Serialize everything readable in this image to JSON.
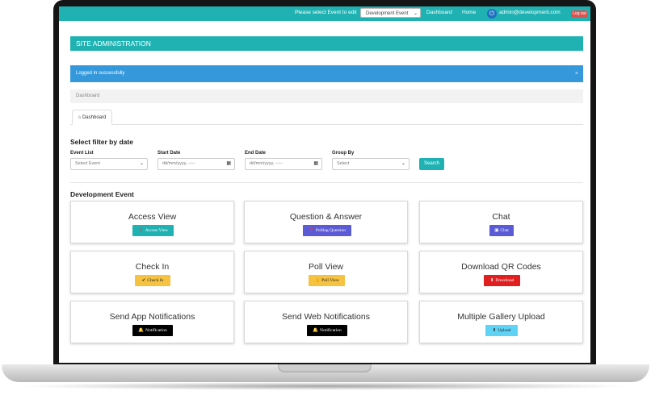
{
  "nav": {
    "select_prompt": "Please select Event to edit",
    "selected_event": "Development Event",
    "dashboard_link": "Dashboard",
    "home_link": "Home",
    "user_email": "admin@development.com",
    "logout_label": "Log out"
  },
  "admin_title": "SITE ADMINISTRATION",
  "alert": {
    "message": "Logged in successfully",
    "close": "×"
  },
  "breadcrumb": "Dashboard",
  "tab": {
    "label": "Dashboard",
    "icon": "home-icon"
  },
  "filter": {
    "title": "Select filter by date",
    "event_list_label": "Event List",
    "event_list_value": "Select Event",
    "start_date_label": "Start Date",
    "start_date_value": "dd/mm/yyyy, --:--",
    "end_date_label": "End Date",
    "end_date_value": "dd/mm/yyyy, --:--",
    "group_by_label": "Group By",
    "group_by_value": "Select",
    "search_label": "Search"
  },
  "section_title": "Development Event",
  "cards": [
    {
      "title": "Access View",
      "button": "Access View",
      "icon": "question-circle-icon",
      "color": "#20b2b2"
    },
    {
      "title": "Question & Answer",
      "button": "Polling Question",
      "icon": "question-circle-icon",
      "color": "#5b5bd6"
    },
    {
      "title": "Chat",
      "button": "Chat",
      "icon": "chat-icon",
      "color": "#5b5bd6"
    },
    {
      "title": "Check In",
      "button": "Check In",
      "icon": "check-icon",
      "color": "#f5c242"
    },
    {
      "title": "Poll View",
      "button": "Poll View",
      "icon": "thumbs-up-icon",
      "color": "#f5c242"
    },
    {
      "title": "Download QR Codes",
      "button": "Download",
      "icon": "download-icon",
      "color": "#e02020"
    },
    {
      "title": "Send App Notifications",
      "button": "Notification",
      "icon": "bell-icon",
      "color": "#000000"
    },
    {
      "title": "Send Web Notifications",
      "button": "Notification",
      "icon": "bell-icon",
      "color": "#000000"
    },
    {
      "title": "Multiple Gallery Upload",
      "button": "Upload",
      "icon": "upload-icon",
      "color": "#5fd3f5"
    }
  ],
  "colors": {
    "teal": "#20b2b2",
    "alert_blue": "#3498db",
    "logout_red": "#d9534f"
  }
}
